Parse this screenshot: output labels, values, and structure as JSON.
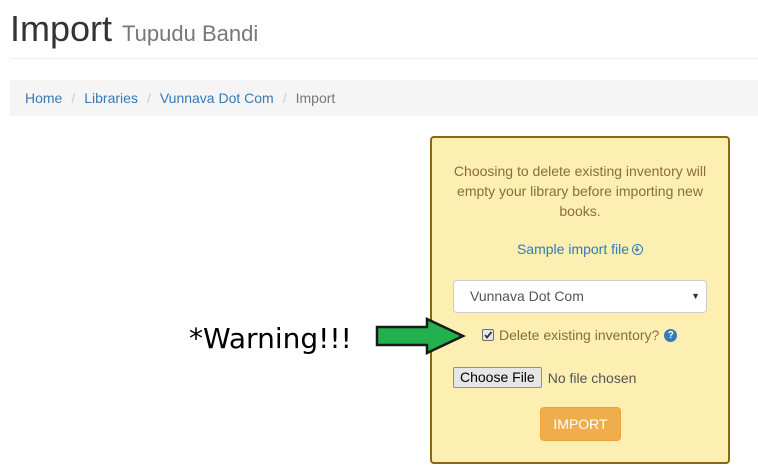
{
  "header": {
    "title": "Import",
    "subtitle": "Tupudu Bandi"
  },
  "breadcrumb": {
    "items": [
      "Home",
      "Libraries",
      "Vunnava Dot Com"
    ],
    "separator": "/",
    "active": "Import"
  },
  "panel": {
    "warning_text": "Choosing to delete existing inventory will empty your library before importing new books.",
    "sample_link": "Sample import file",
    "sample_link_icon": "download-circle-icon",
    "library_select": {
      "selected": "Vunnava Dot Com"
    },
    "delete_checkbox": {
      "label": "Delete existing inventory?",
      "checked": true,
      "help_icon": "question-circle-icon"
    },
    "file_input": {
      "button_label": "Choose File",
      "status": "No file chosen"
    },
    "import_button": "IMPORT"
  },
  "annotation": {
    "text": "*Warning!!!",
    "arrow_icon": "green-arrow-right-icon"
  },
  "colors": {
    "panel_bg": "#fcefb1",
    "panel_border": "#8b6914",
    "link": "#337ab7",
    "warning_text": "#8a6d3b",
    "import_button": "#f0ad4e",
    "arrow": "#22b14c"
  }
}
